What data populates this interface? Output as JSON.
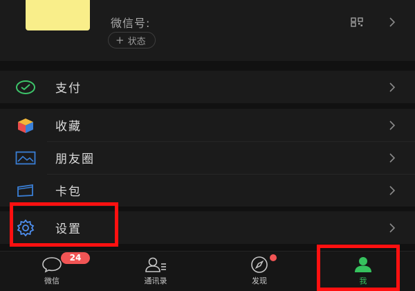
{
  "profile": {
    "wechat_id_label": "微信号:",
    "status_plus": "+",
    "status_label": "状态",
    "avatar_color": "#f9ee8a"
  },
  "menu": {
    "pay": {
      "label": "支付",
      "icon": "wallet-check-icon",
      "color": "#3dc46a"
    },
    "favorites": {
      "label": "收藏",
      "icon": "cube-icon"
    },
    "moments": {
      "label": "朋友圈",
      "icon": "picture-icon",
      "color": "#3a7fd6"
    },
    "cards": {
      "label": "卡包",
      "icon": "card-wallet-icon",
      "color": "#3a7fd6"
    },
    "settings": {
      "label": "设置",
      "icon": "gear-icon",
      "color": "#4e8ff0"
    }
  },
  "tabbar": {
    "chats": {
      "label": "微信",
      "badge": "24",
      "icon": "chat-bubble-icon"
    },
    "contacts": {
      "label": "通讯录",
      "icon": "contacts-icon"
    },
    "discover": {
      "label": "发现",
      "icon": "compass-icon",
      "has_dot": true
    },
    "me": {
      "label": "我",
      "icon": "person-icon",
      "active": true
    }
  },
  "colors": {
    "accent_green": "#36c25e",
    "badge_red": "#f25555",
    "highlight_red": "#ff1010"
  }
}
